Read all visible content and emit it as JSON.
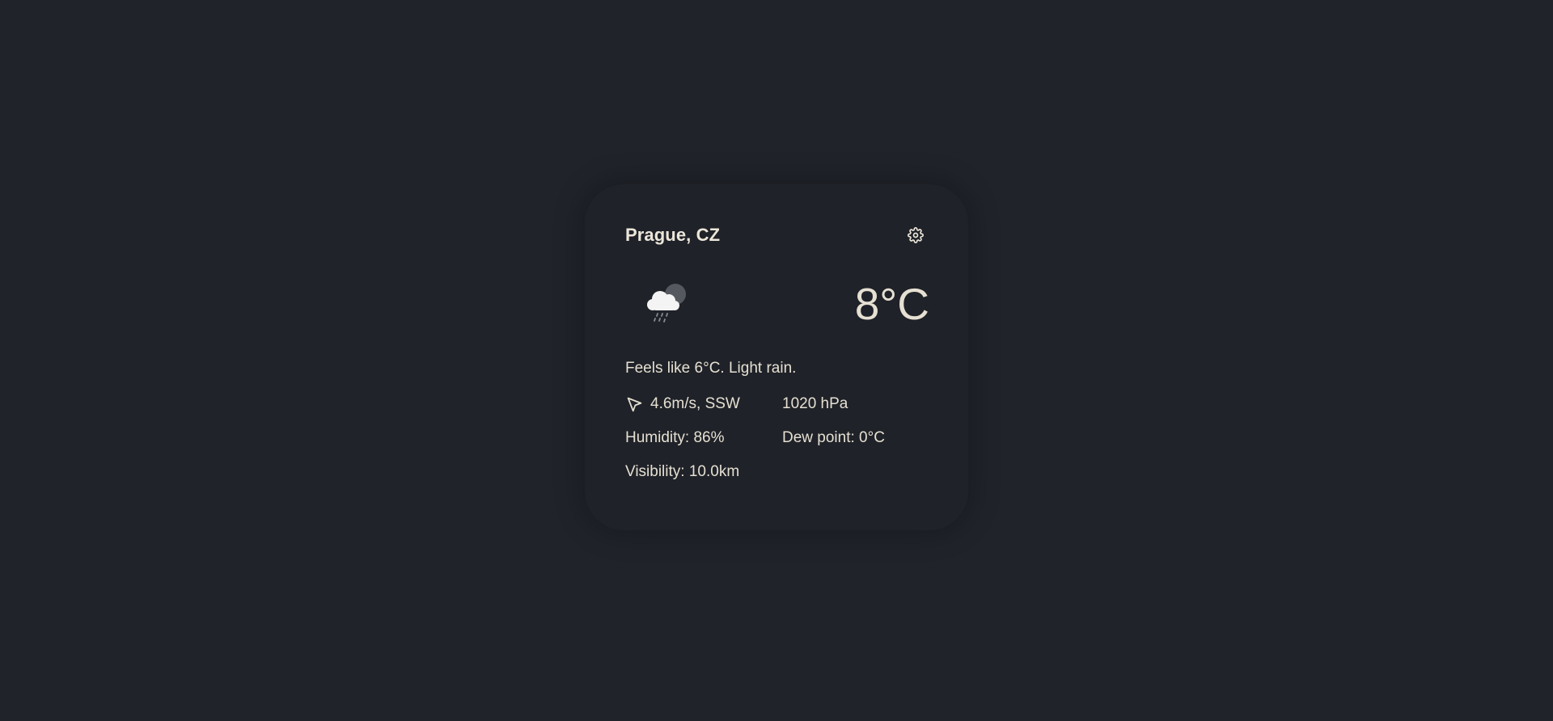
{
  "widget": {
    "location": "Prague, CZ",
    "temperature": "8°C",
    "summary": "Feels like 6°C. Light rain.",
    "wind": "4.6m/s, SSW",
    "pressure": "1020 hPa",
    "humidity": "Humidity: 86%",
    "dew_point": "Dew point: 0°C",
    "visibility": "Visibility: 10.0km",
    "condition_icon": "cloud-rain-moon-icon",
    "settings_icon": "gear-icon",
    "wind_icon": "wind-direction-arrow-icon"
  },
  "colors": {
    "background": "#20232a",
    "card": "#1f2228",
    "text": "#e6e0d3"
  }
}
